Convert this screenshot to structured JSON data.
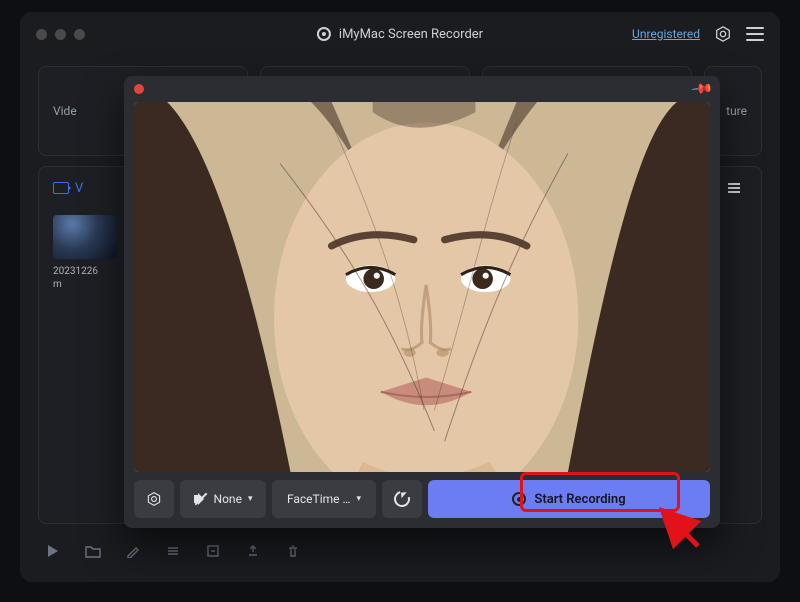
{
  "header": {
    "app_title": "iMyMac Screen Recorder",
    "unregistered_label": "Unregistered"
  },
  "background": {
    "tab_left_hint": "Vide",
    "tab_right_hint": "ture",
    "panel_head_hint": "V",
    "thumbnail_caption_line1": "20231226",
    "thumbnail_caption_line2": "m"
  },
  "modal": {
    "audio_button_label": "None",
    "device_button_label": "FaceTime …",
    "start_button_label": "Start Recording"
  }
}
